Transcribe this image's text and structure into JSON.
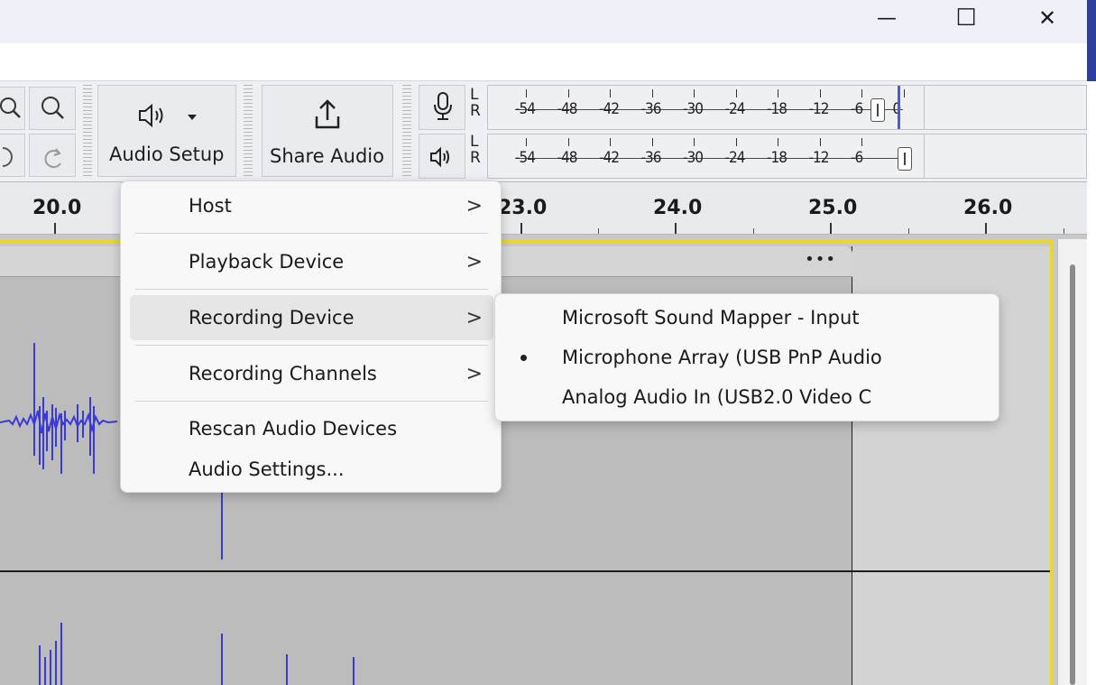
{
  "window": {
    "minimize_glyph": "—",
    "maximize_glyph": "☐",
    "close_glyph": "✕"
  },
  "toolbar": {
    "audio_setup_label": "Audio Setup",
    "share_audio_label": "Share Audio",
    "icons": [
      "zoom-out-icon",
      "zoom-in-icon",
      "undo-icon",
      "redo-icon",
      "speaker-icon",
      "dropdown-arrow-icon",
      "share-icon",
      "microphone-icon"
    ]
  },
  "meters": {
    "recording": {
      "channels": [
        "L",
        "R"
      ],
      "ticks": [
        "-54",
        "-48",
        "-42",
        "-36",
        "-30",
        "-24",
        "-18",
        "-12",
        "-6",
        "0"
      ]
    },
    "playback": {
      "channels": [
        "L",
        "R"
      ],
      "ticks": [
        "-54",
        "-48",
        "-42",
        "-36",
        "-30",
        "-24",
        "-18",
        "-12",
        "-6"
      ]
    }
  },
  "ruler": {
    "labels": [
      "20.0",
      "23.0",
      "24.0",
      "25.0",
      "26.0"
    ]
  },
  "clip": {
    "menu_glyph": "•••"
  },
  "audio_setup_menu": {
    "items": [
      {
        "label": "Host",
        "submenu": true
      },
      {
        "label": "Playback Device",
        "submenu": true
      },
      {
        "label": "Recording Device",
        "submenu": true,
        "highlighted": true
      },
      {
        "label": "Recording Channels",
        "submenu": true
      },
      {
        "label": "Rescan Audio Devices",
        "submenu": false
      },
      {
        "label": "Audio Settings...",
        "submenu": false
      }
    ],
    "chevron": ">"
  },
  "recording_device_submenu": {
    "items": [
      {
        "label": "Microsoft Sound Mapper - Input",
        "selected": false
      },
      {
        "label": "Microphone Array (USB PnP Audio",
        "selected": true
      },
      {
        "label": "Analog Audio In (USB2.0 Video C",
        "selected": false
      }
    ]
  },
  "colors": {
    "waveform": "#3a3ad8",
    "selection_frame": "#e8d82e",
    "menu_bg": "#f8f8f8",
    "highlight": "#e6e6e6"
  }
}
